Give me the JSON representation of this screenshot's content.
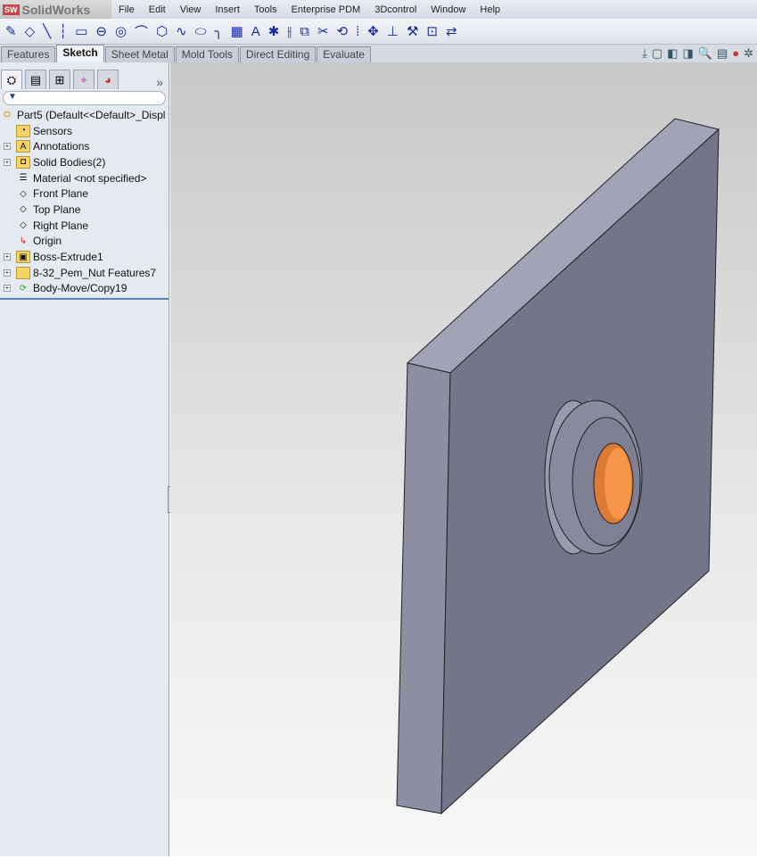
{
  "app": {
    "title": "SolidWorks",
    "logo_badge": "SW"
  },
  "menu": [
    "File",
    "Edit",
    "View",
    "Insert",
    "Tools",
    "Enterprise PDM",
    "3Dcontrol",
    "Window",
    "Help"
  ],
  "toolbar_icons": [
    "sketch-icon",
    "smart-dimension-icon",
    "line-icon",
    "centerline-icon",
    "rectangle-icon",
    "slot-icon",
    "circle-icon",
    "arc-icon",
    "polygon-icon",
    "spline-icon",
    "ellipse-icon",
    "fillet-icon",
    "plane-icon",
    "text-icon",
    "point-icon",
    "mirror-icon",
    "offset-icon",
    "trim-icon",
    "convert-icon",
    "pattern-icon",
    "move-icon",
    "relations-icon",
    "repair-icon",
    "quick-snaps-icon",
    "rapid-sketch-icon"
  ],
  "tabs": [
    {
      "label": "Features"
    },
    {
      "label": "Sketch",
      "active": true
    },
    {
      "label": "Sheet Metal"
    },
    {
      "label": "Mold Tools"
    },
    {
      "label": "Direct Editing"
    },
    {
      "label": "Evaluate"
    }
  ],
  "tree": {
    "root": "Part5  (Default<<Default>_Displ",
    "items": [
      {
        "label": "Sensors",
        "icon": "sensors-icon",
        "expand": false
      },
      {
        "label": "Annotations",
        "icon": "annotations-icon",
        "expand": true
      },
      {
        "label": "Solid Bodies(2)",
        "icon": "solid-bodies-icon",
        "expand": true
      },
      {
        "label": "Material <not specified>",
        "icon": "material-icon",
        "expand": false
      },
      {
        "label": "Front Plane",
        "icon": "plane-icon",
        "expand": false
      },
      {
        "label": "Top Plane",
        "icon": "plane-icon",
        "expand": false
      },
      {
        "label": "Right Plane",
        "icon": "plane-icon",
        "expand": false
      },
      {
        "label": "Origin",
        "icon": "origin-icon",
        "expand": false
      },
      {
        "label": "Boss-Extrude1",
        "icon": "extrude-icon",
        "expand": true
      },
      {
        "label": "8-32_Pem_Nut Features7",
        "icon": "folder-icon",
        "expand": true
      },
      {
        "label": "Body-Move/Copy19",
        "icon": "move-copy-icon",
        "expand": true
      }
    ]
  },
  "colors": {
    "plate_front": "#75758a",
    "plate_side": "#8e8ea2",
    "plate_top": "#a3a3b8",
    "hole": "#f7954a"
  }
}
